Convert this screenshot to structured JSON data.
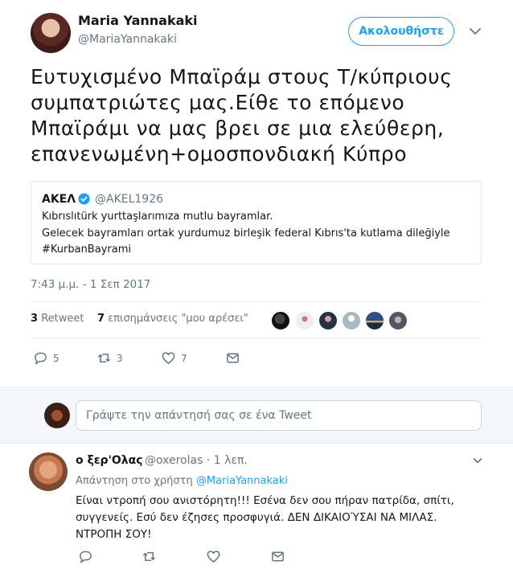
{
  "tweet": {
    "author_name": "Maria Yannakaki",
    "author_handle": "@MariaYannakaki",
    "follow_label": "Ακολουθήστε",
    "text_lines": [
      "Ευτυχισμένο Μπαϊράμ στους Τ/κύπριους",
      "συμπατριώτες μας.Είθε το επόμενο",
      "Μπαϊράμι να μας βρει σε μια ελεύθερη,",
      "επανενωμένη+ομοσπονδιακή Κύπρο"
    ],
    "quote": {
      "name": "ΑΚΕΛ",
      "handle": "@AKEL1926",
      "lines": [
        "Kıbrıslıtürk yurttaşlarımıza mutlu bayramlar.",
        "Gelecek bayramları ortak yurdumuz birleşik federal Kıbrıs'ta kutlama dileğiyle",
        "#KurbanBayrami"
      ]
    },
    "timestamp": "7:43 μ.μ. - 1 Σεπ 2017",
    "stats": {
      "retweets_count": "3",
      "retweets_label": "Retweet",
      "likes_count": "7",
      "likes_label": "επισημάνσεις \"μου αρέσει\""
    },
    "actions": {
      "reply_count": "5",
      "retweet_count": "3",
      "like_count": "7"
    }
  },
  "compose": {
    "placeholder": "Γράψτε την απάντησή σας σε ένα Tweet"
  },
  "reply": {
    "name": "ο ξερ'Ολας",
    "handle_time": "@oxerolas · 1 λεπ.",
    "reply_to_prefix": "Απάντηση στο χρήστη",
    "reply_to_handle": "@MariaYannakaki",
    "text_lines": [
      "Είναι ντροπή σου ανιστόρητη!!! Εσένα δεν σου πήραν πατρίδα, σπίτι,",
      "συγγενείς. Εσύ δεν έζησες προσφυγιά. ΔΕΝ ΔΙΚΑΙΟΎΣΑΙ ΝΑ ΜΙΛΑΣ.",
      "ΝΤΡΟΠΗ ΣΟΥ!"
    ]
  },
  "colors": {
    "accent": "#1da1f2",
    "secondary_text": "#657786",
    "border": "#e6ecf0"
  }
}
